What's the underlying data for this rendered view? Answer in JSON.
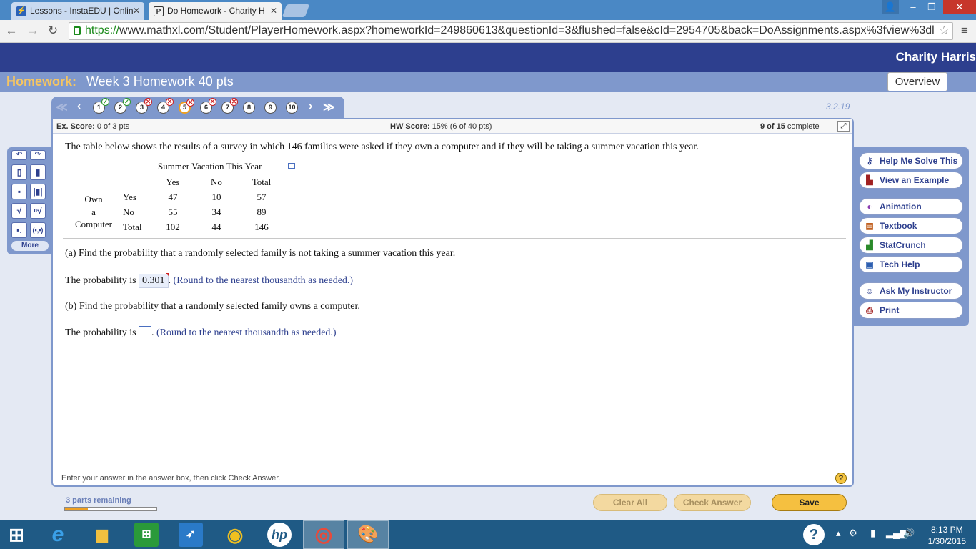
{
  "browser": {
    "tabs": [
      {
        "title": "Lessons - InstaEDU | Onlin",
        "icon": "lightning-icon"
      },
      {
        "title": "Do Homework - Charity H",
        "icon": "p-icon"
      }
    ],
    "url_scheme": "https://",
    "url_rest": "www.mathxl.com/Student/PlayerHomework.aspx?homeworkId=249860613&questionId=3&flushed=false&cId=2954705&back=DoAssignments.aspx%3fview%3dl"
  },
  "header": {
    "student_name": "Charity Harris",
    "homework_label": "Homework:",
    "homework_title": "Week 3 Homework 40 pts",
    "overview_label": "Overview"
  },
  "question_nav": {
    "questions": [
      {
        "num": "1",
        "status": "correct"
      },
      {
        "num": "2",
        "status": "correct"
      },
      {
        "num": "3",
        "status": "incorrect"
      },
      {
        "num": "4",
        "status": "incorrect"
      },
      {
        "num": "5",
        "status": "incorrect-current"
      },
      {
        "num": "6",
        "status": "incorrect"
      },
      {
        "num": "7",
        "status": "incorrect"
      },
      {
        "num": "8",
        "status": "none"
      },
      {
        "num": "9",
        "status": "none"
      },
      {
        "num": "10",
        "status": "none"
      }
    ],
    "section_id": "3.2.19"
  },
  "scores": {
    "ex_label": "Ex. Score:",
    "ex_value": "0 of 3 pts",
    "hw_label": "HW Score:",
    "hw_value": "15% (6 of 40 pts)",
    "complete_bold": "9 of 15",
    "complete_text": "complete"
  },
  "question": {
    "intro": "The table below shows the results of a survey in which 146 families were asked if they own a computer and if they will be taking a summer vacation this year.",
    "table": {
      "col_group": "Summer Vacation This Year",
      "cols": [
        "Yes",
        "No",
        "Total"
      ],
      "row_group": [
        "Own",
        "a",
        "Computer"
      ],
      "rows": [
        {
          "label": "Yes",
          "values": [
            "47",
            "10",
            "57"
          ]
        },
        {
          "label": "No",
          "values": [
            "55",
            "34",
            "89"
          ]
        },
        {
          "label": "Total",
          "values": [
            "102",
            "44",
            "146"
          ]
        }
      ]
    },
    "part_a": "(a) Find the probability that a randomly selected family is not taking a summer vacation this year.",
    "part_a_prefix": "The probability is",
    "part_a_answer": "0.301",
    "round_note": "(Round to the nearest thousandth as needed.)",
    "part_b": "(b) Find the probability that a randomly selected family owns a computer.",
    "part_b_prefix": "The probability is",
    "footer_hint": "Enter your answer in the answer box, then click Check Answer."
  },
  "tools": {
    "more_label": "More"
  },
  "help_buttons": [
    {
      "label": "Help Me Solve This",
      "icon": "key-icon"
    },
    {
      "label": "View an Example",
      "icon": "example-icon"
    },
    {
      "label": "Animation",
      "icon": "animation-icon"
    },
    {
      "label": "Textbook",
      "icon": "book-icon"
    },
    {
      "label": "StatCrunch",
      "icon": "chart-icon"
    },
    {
      "label": "Tech Help",
      "icon": "monitor-icon"
    },
    {
      "label": "Ask My Instructor",
      "icon": "person-icon"
    },
    {
      "label": "Print",
      "icon": "printer-icon"
    }
  ],
  "bottom": {
    "parts_remaining": "3 parts remaining",
    "progress_fraction": 0.25,
    "clear_all": "Clear All",
    "check_answer": "Check Answer",
    "save": "Save"
  },
  "taskbar": {
    "time": "8:13 PM",
    "date": "1/30/2015"
  }
}
